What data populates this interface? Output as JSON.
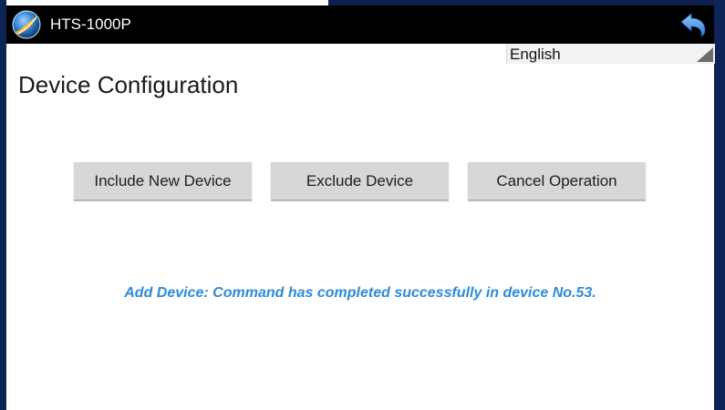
{
  "window": {
    "title": "HTS-1000P",
    "logo_icon": "app-logo-icon",
    "back_icon": "back-arrow-icon"
  },
  "language": {
    "selected": "English"
  },
  "page": {
    "title": "Device Configuration"
  },
  "actions": {
    "include_label": "Include New Device",
    "exclude_label": "Exclude Device",
    "cancel_label": "Cancel Operation"
  },
  "status": {
    "message": "Add Device: Command has completed successfully in device No.53."
  },
  "colors": {
    "titlebar": "#000000",
    "status_text": "#2e8bd6",
    "button_bg": "#d7d7d7",
    "frame": "#0d1f4d"
  }
}
